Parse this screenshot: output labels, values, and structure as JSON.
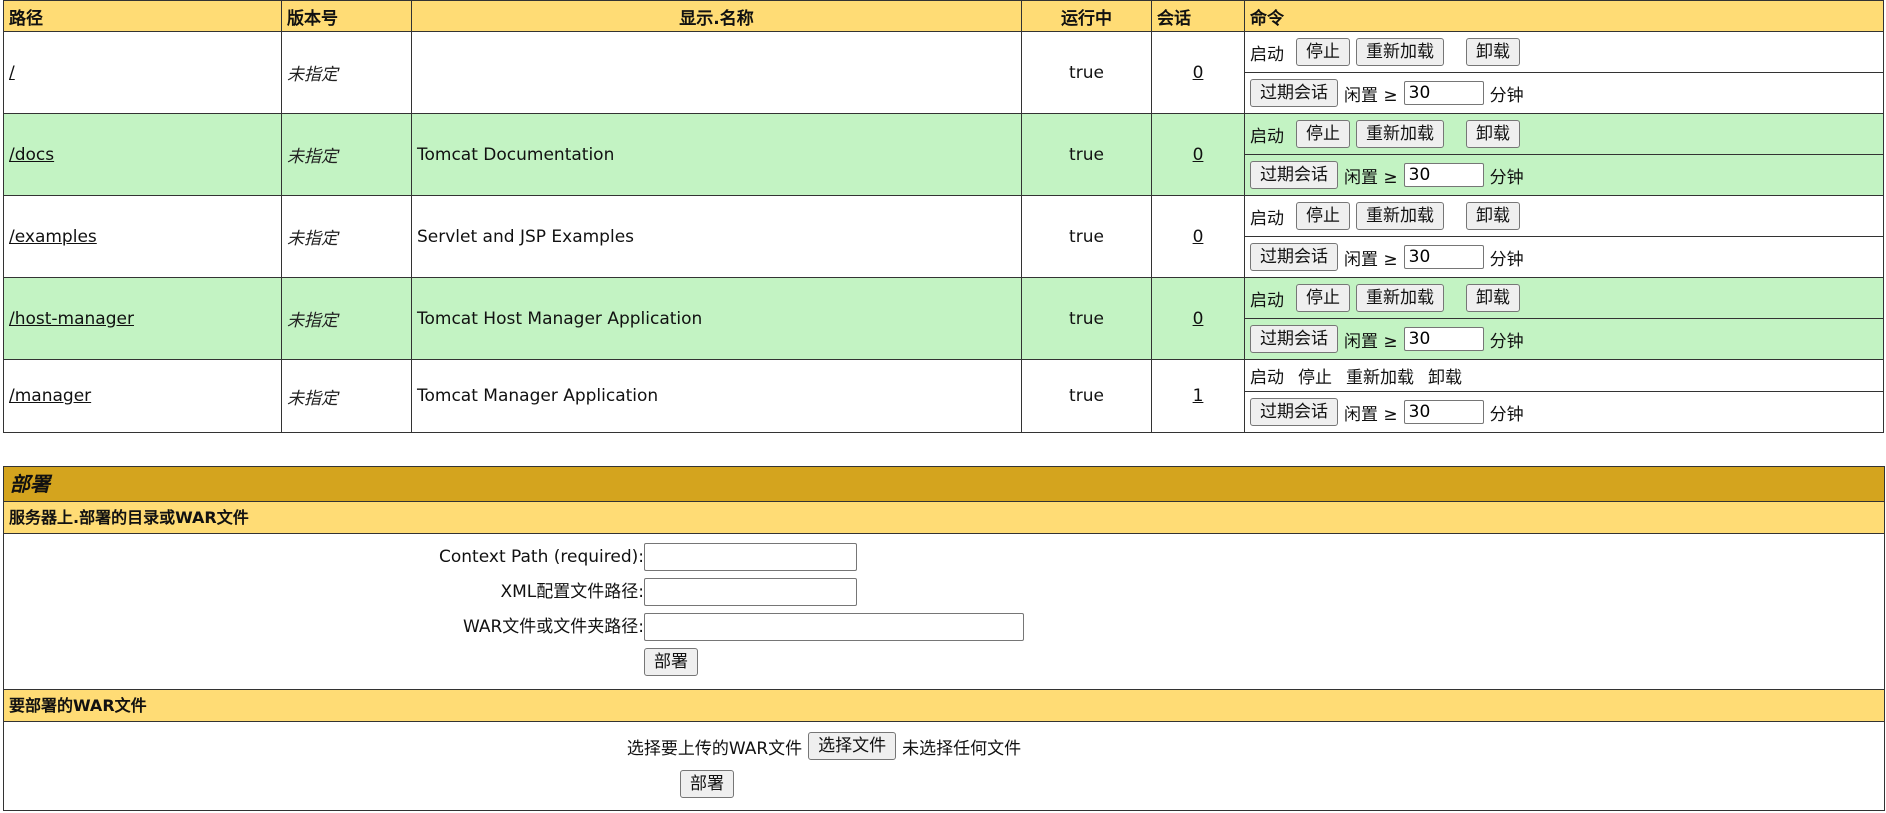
{
  "apps_table": {
    "headers": {
      "path": "路径",
      "version": "版本号",
      "display_name": "显示.名称",
      "running": "运行中",
      "sessions": "会话",
      "commands": "命令"
    },
    "rows": [
      {
        "path": "/",
        "version": "未指定",
        "display_name": "",
        "running": "true",
        "sessions": "0",
        "idle": "30"
      },
      {
        "path": "/docs",
        "version": "未指定",
        "display_name": "Tomcat Documentation",
        "running": "true",
        "sessions": "0",
        "idle": "30"
      },
      {
        "path": "/examples",
        "version": "未指定",
        "display_name": "Servlet and JSP Examples",
        "running": "true",
        "sessions": "0",
        "idle": "30"
      },
      {
        "path": "/host-manager",
        "version": "未指定",
        "display_name": "Tomcat Host Manager Application",
        "running": "true",
        "sessions": "0",
        "idle": "30"
      },
      {
        "path": "/manager",
        "version": "未指定",
        "display_name": "Tomcat Manager Application",
        "running": "true",
        "sessions": "1",
        "idle": "30"
      }
    ],
    "cmd": {
      "start": "启动",
      "stop": "停止",
      "reload": "重新加载",
      "undeploy": "卸载",
      "expire": "过期会话",
      "idle_label": "闲置 ≥",
      "minutes": "分钟"
    }
  },
  "deploy": {
    "title": "部署",
    "server_section": "服务器上.部署的目录或WAR文件",
    "context_path_label": "Context Path (required):",
    "xml_path_label": "XML配置文件路径:",
    "war_path_label": "WAR文件或文件夹路径:",
    "deploy_button": "部署",
    "upload_section": "要部署的WAR文件",
    "upload_label": "选择要上传的WAR文件",
    "choose_file_button": "选择文件",
    "no_file_text": "未选择任何文件",
    "upload_deploy_button": "部署"
  },
  "colors": {
    "header_bg": "#ffdc75",
    "alt_row_bg": "#c3f3c3",
    "section_title_bg": "#d4a41e"
  }
}
